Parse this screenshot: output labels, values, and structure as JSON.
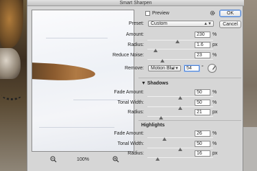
{
  "window": {
    "title": "Smart Sharpen"
  },
  "buttons": {
    "ok": "OK",
    "cancel": "Cancel"
  },
  "preview": {
    "label": "Preview",
    "checked": false,
    "zoom": "100%"
  },
  "preset": {
    "label": "Preset:",
    "value": "Custom"
  },
  "sharpen": {
    "amount": {
      "label": "Amount:",
      "value": "230",
      "unit": "%",
      "slider": 0.46
    },
    "radius": {
      "label": "Radius:",
      "value": "1.6",
      "unit": "px",
      "slider": 0.12
    },
    "reduce_noise": {
      "label": "Reduce Noise:",
      "value": "23",
      "unit": "%",
      "slider": 0.23
    }
  },
  "remove": {
    "label": "Remove:",
    "value": "Motion Blur",
    "angle": "54",
    "angle_unit": "°"
  },
  "shadows": {
    "heading": "Shadows",
    "fade_amount": {
      "label": "Fade Amount:",
      "value": "50",
      "unit": "%",
      "slider": 0.5
    },
    "tonal_width": {
      "label": "Tonal Width:",
      "value": "50",
      "unit": "%",
      "slider": 0.5
    },
    "radius": {
      "label": "Radius:",
      "value": "21",
      "unit": "px",
      "slider": 0.21
    }
  },
  "highlights": {
    "heading": "Highlights",
    "fade_amount": {
      "label": "Fade Amount:",
      "value": "26",
      "unit": "%",
      "slider": 0.26
    },
    "tonal_width": {
      "label": "Tonal Width:",
      "value": "50",
      "unit": "%",
      "slider": 0.5
    },
    "radius": {
      "label": "Radius:",
      "value": "16",
      "unit": "px",
      "slider": 0.16
    }
  },
  "icons": {
    "settings": "gear-icon",
    "zoom_out": "zoom-out-icon",
    "zoom_in": "zoom-in-icon",
    "shadows_toggle": "disclosure-triangle-icon",
    "angle": "angle-dial-icon"
  }
}
